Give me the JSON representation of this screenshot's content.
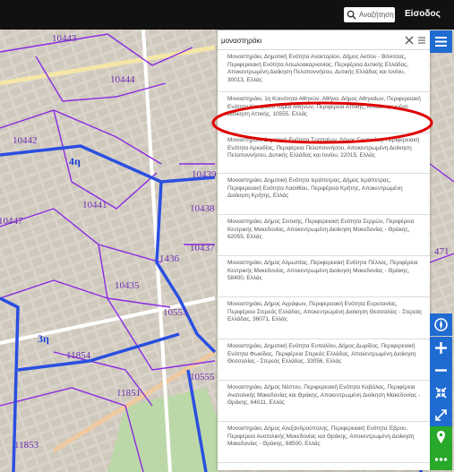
{
  "header": {
    "search_placeholder": "Αναζήτηση",
    "login_label": "Είσοδος"
  },
  "search": {
    "query": "μοναστηράκι"
  },
  "map": {
    "zone_labels": [
      "10443",
      "10442",
      "10444",
      "10441",
      "10447",
      "10439",
      "10438",
      "10435",
      "10437",
      "1436",
      "10553",
      "11854",
      "11851",
      "10555",
      "11853",
      "11742",
      "471"
    ],
    "district_labels": [
      "4η",
      "3η"
    ]
  },
  "results": [
    "Μοναστηράκι, Δημοτική Ενότητα Ανακτορίου, Δήμος Ακτίου - Βόνιτσας, Περιφερειακή Ενότητα Αιτωλοακαρνανίας, Περιφέρεια Δυτικής Ελλάδας, Αποκεντρωμένη Διοίκηση Πελοποννήσου, Δυτικής Ελλάδας και Ιονίου, 30013, Ελλάς",
    "Μοναστηράκι, 1η Κοινότητα Αθηνών, Αθήνα, Δήμος Αθηναίων, Περιφερειακή Ενότητα Κεντρικού Τομέα Αθηνών, Περιφέρεια Αττικής, Αποκεντρωμένη Διοίκηση Αττικής, 10555, Ελλάς",
    "Μοναστηράκι, Δημοτική Ενότητα Τροπαίων, Δήμος Γορτυνίας, Περιφερειακή Ενότητα Αρκαδίας, Περιφέρεια Πελοποννήσου, Αποκεντρωμένη Διοίκηση Πελοποννήσου, Δυτικής Ελλάδας και Ιονίου, 22015, Ελλάς",
    "Μοναστηράκι, Δημοτική Ενότητα Ιεράπετρας, Δήμος Ιεράπετρας, Περιφερειακή Ενότητα Λασιθίου, Περιφέρεια Κρήτης, Αποκεντρωμένη Διοίκηση Κρήτης, Ελλάς",
    "Μοναστηράκι, Δήμος Σιντικής, Περιφερειακή Ενότητα Σερρών, Περιφέρεια Κεντρικής Μακεδονίας, Αποκεντρωμένη Διοίκηση Μακεδονίας - Θράκης, 62055, Ελλάς",
    "Μοναστηράκι, Δήμος Αλμωπίας, Περιφερειακή Ενότητα Πέλλας, Περιφέρεια Κεντρικής Μακεδονίας, Αποκεντρωμένη Διοίκηση Μακεδονίας - Θράκης, 58400, Ελλάς",
    "Μοναστηράκι, Δήμος Αγράφων, Περιφερειακή Ενότητα Ευρυτανίας, Περιφέρεια Στερεάς Ελλάδας, Αποκεντρωμένη Διοίκηση Θεσσαλίας - Στερεάς Ελλάδας, 36071, Ελλάς",
    "Μοναστηράκι, Δημοτική Ενότητα Ευπαλίου, Δήμος Δωρίδος, Περιφερειακή Ενότητα Φωκίδας, Περιφέρεια Στερεάς Ελλάδας, Αποκεντρωμένη Διοίκηση Θεσσαλίας - Στερεάς Ελλάδας, 33056, Ελλάς",
    "Μοναστηράκι, Δήμος Νέστου, Περιφερειακή Ενότητα Καβάλας, Περιφέρεια Ανατολικής Μακεδονίας και Θράκης, Αποκεντρωμένη Διοίκηση Μακεδονίας - Θράκης, 64011, Ελλάς",
    "Μοναστηράκι, Δήμος Αλεξανδρούπολης, Περιφερειακή Ενότητα Έβρου, Περιφέρεια Ανατολικής Μακεδονίας και Θράκης, Αποκεντρωμένη Διοίκηση Μακεδονίας - Θράκης, 68500, Ελλάς"
  ],
  "colors": {
    "accent": "#1f6bd1",
    "highlight_circle": "#e00000",
    "location_button": "#29a829"
  }
}
